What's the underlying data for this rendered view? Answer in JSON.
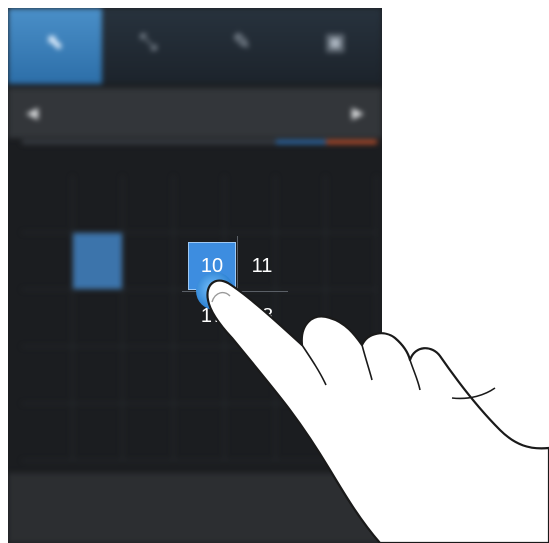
{
  "tabs": [
    {
      "label": "",
      "icon": "select-icon",
      "active": true
    },
    {
      "label": "",
      "icon": "calendar-icon",
      "active": false
    },
    {
      "label": "",
      "icon": "pen-icon",
      "active": false
    },
    {
      "label": "",
      "icon": "trash-icon",
      "active": false
    }
  ],
  "header": {
    "prev_icon": "chevron-left-icon",
    "next_icon": "chevron-right-icon",
    "month_label": ""
  },
  "calendar": {
    "weekdays": [
      "",
      "",
      "",
      "",
      "",
      "",
      ""
    ],
    "selected_day": "10",
    "zoom_cells": [
      "10",
      "11",
      "17",
      "18"
    ]
  },
  "bottom_bar": {
    "label": ""
  },
  "colors": {
    "accent": "#3d8de0",
    "saturday": "#3e86c9",
    "sunday": "#c75432",
    "background": "#1b1d20"
  }
}
